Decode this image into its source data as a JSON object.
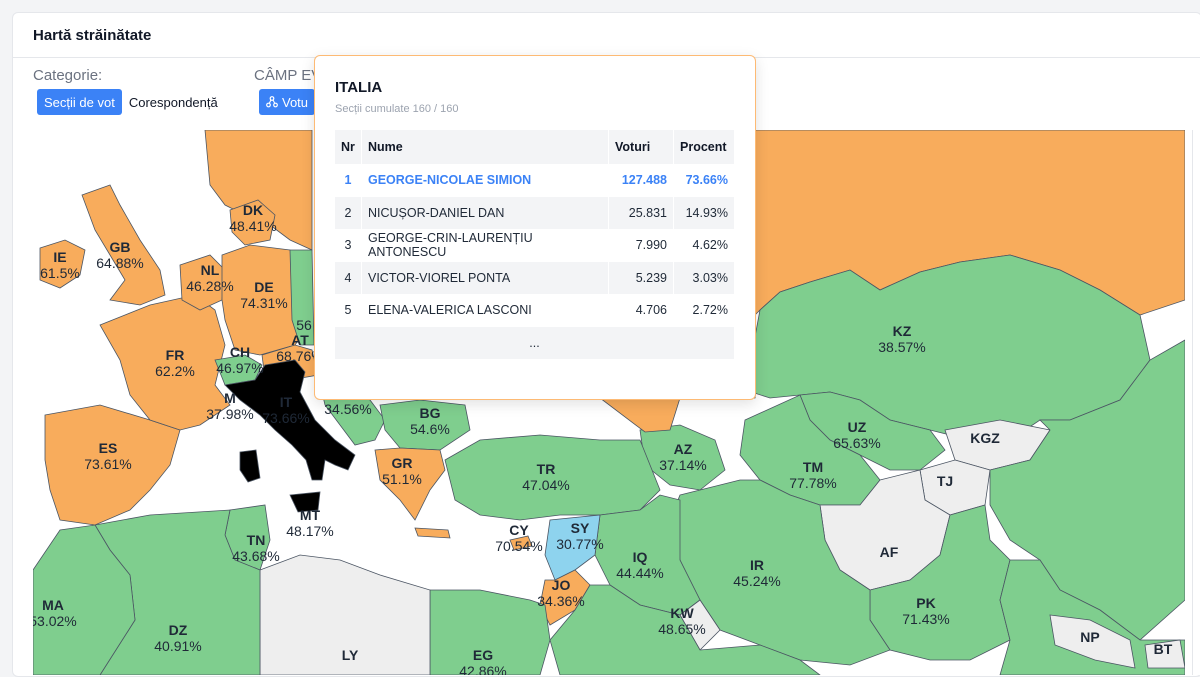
{
  "header": {
    "title": "Hartă străinătate"
  },
  "filters": {
    "category_label": "Categorie:",
    "category_options": [
      "Secții de vot",
      "Corespondență"
    ],
    "category_selected": "Secții de vot",
    "field_label": "CÂMP EV",
    "field_option": "Votu"
  },
  "colors": {
    "orange": "#f8ac5c",
    "green": "#7fce8e",
    "gray": "#eeeeee",
    "blue": "#8ed3ee",
    "selected": "#000000",
    "accent": "#3b82f6"
  },
  "map": {
    "countries": [
      {
        "code": "IE",
        "pct": "61.5%"
      },
      {
        "code": "GB",
        "pct": "64.88%"
      },
      {
        "code": "NL",
        "pct": "46.28%"
      },
      {
        "code": "DK",
        "pct": "48.41%"
      },
      {
        "code": "DE",
        "pct": "74.31%"
      },
      {
        "code": "FR",
        "pct": "62.2%"
      },
      {
        "code": "CH",
        "pct": "46.97%"
      },
      {
        "code": "AT",
        "pct": "68.76%"
      },
      {
        "code": "M",
        "pct": "37.98%"
      },
      {
        "code": "IT",
        "pct": "73.66%"
      },
      {
        "code": "ES",
        "pct": "73.61%"
      },
      {
        "code": "BG",
        "pct": "54.6%"
      },
      {
        "code": "",
        "pct": "34.56%"
      },
      {
        "code": "GR",
        "pct": "51.1%"
      },
      {
        "code": "MT",
        "pct": "48.17%"
      },
      {
        "code": "TN",
        "pct": "43.68%"
      },
      {
        "code": "MA",
        "pct": "53.02%"
      },
      {
        "code": "DZ",
        "pct": "40.91%"
      },
      {
        "code": "LY",
        "pct": ""
      },
      {
        "code": "EG",
        "pct": "42.86%"
      },
      {
        "code": "TR",
        "pct": "47.04%"
      },
      {
        "code": "CY",
        "pct": "70.54%"
      },
      {
        "code": "SY",
        "pct": "30.77%"
      },
      {
        "code": "JO",
        "pct": "34.36%"
      },
      {
        "code": "IQ",
        "pct": "44.44%"
      },
      {
        "code": "KW",
        "pct": "48.65%"
      },
      {
        "code": "IR",
        "pct": "45.24%"
      },
      {
        "code": "AZ",
        "pct": "37.14%"
      },
      {
        "code": "TM",
        "pct": "77.78%"
      },
      {
        "code": "UZ",
        "pct": "65.63%"
      },
      {
        "code": "KZ",
        "pct": "38.57%"
      },
      {
        "code": "KGZ",
        "pct": ""
      },
      {
        "code": "TJ",
        "pct": ""
      },
      {
        "code": "AF",
        "pct": ""
      },
      {
        "code": "PK",
        "pct": "71.43%"
      },
      {
        "code": "NP",
        "pct": ""
      },
      {
        "code": "BT",
        "pct": ""
      }
    ],
    "partial": [
      {
        "text": "56"
      }
    ]
  },
  "popup": {
    "country": "ITALIA",
    "subtitle": "Secții cumulate 160 / 160",
    "columns": [
      "Nr",
      "Nume",
      "Voturi",
      "Procent"
    ],
    "rows": [
      {
        "nr": "1",
        "name": "GEORGE-NICOLAE SIMION",
        "votes": "127.488",
        "pct": "73.66%"
      },
      {
        "nr": "2",
        "name": "NICUȘOR-DANIEL DAN",
        "votes": "25.831",
        "pct": "14.93%"
      },
      {
        "nr": "3",
        "name": "GEORGE-CRIN-LAURENȚIU ANTONESCU",
        "votes": "7.990",
        "pct": "4.62%"
      },
      {
        "nr": "4",
        "name": "VICTOR-VIOREL PONTA",
        "votes": "5.239",
        "pct": "3.03%"
      },
      {
        "nr": "5",
        "name": "ELENA-VALERICA LASCONI",
        "votes": "4.706",
        "pct": "2.72%"
      }
    ],
    "more": "..."
  }
}
